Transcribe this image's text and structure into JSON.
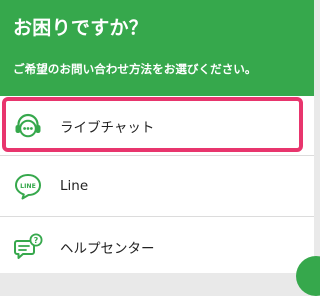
{
  "header": {
    "title": "お困りですか？",
    "subtitle": "ご希望のお問い合わせ方法をお選びください。"
  },
  "options": [
    {
      "label": "ライブチャット",
      "icon": "headset-chat-icon"
    },
    {
      "label": "Line",
      "icon": "line-icon"
    },
    {
      "label": "ヘルプセンター",
      "icon": "help-center-icon"
    }
  ],
  "colors": {
    "brand": "#36a84c",
    "highlight": "#e8356d",
    "panel_background": "#ffffff",
    "page_background": "#e9e9e9"
  }
}
